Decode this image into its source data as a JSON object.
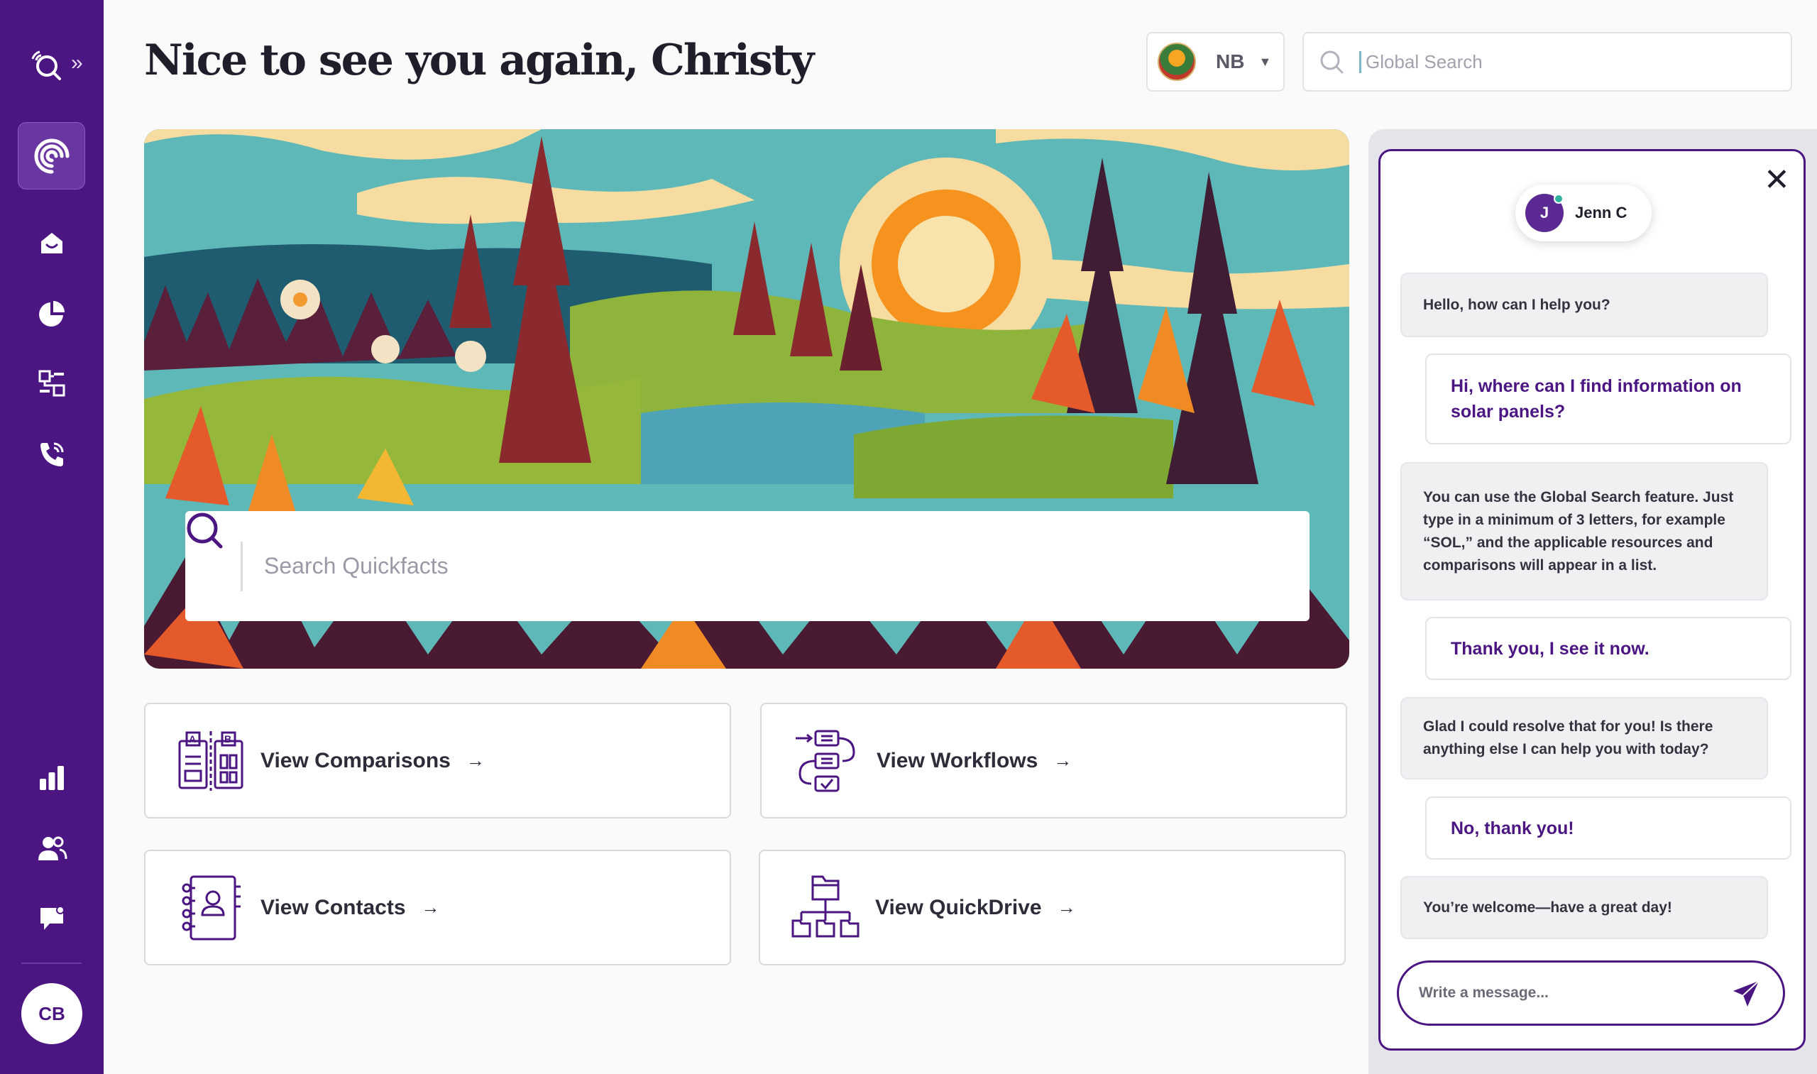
{
  "header": {
    "greeting": "Nice to see you again, Christy",
    "province": "NB",
    "global_search_placeholder": "Global Search"
  },
  "sidebar": {
    "items": [
      {
        "icon": "search-signal-icon"
      },
      {
        "icon": "swirl-logo-icon",
        "active": true
      },
      {
        "icon": "home-icon"
      },
      {
        "icon": "pie-chart-icon"
      },
      {
        "icon": "workflow-icon"
      },
      {
        "icon": "phone-icon"
      },
      {
        "icon": "bar-chart-icon"
      },
      {
        "icon": "users-icon"
      },
      {
        "icon": "chat-bubble-icon"
      }
    ],
    "expand_glyph": "»",
    "user_initials": "CB",
    "colors": {
      "background": "#4b1582",
      "active": "#6a37a2"
    }
  },
  "hero": {
    "quickfacts_placeholder": "Search Quickfacts"
  },
  "cards": [
    {
      "label": "View Comparisons",
      "arrow": "→",
      "icon": "comparison-icon"
    },
    {
      "label": "View Workflows",
      "arrow": "→",
      "icon": "workflow-steps-icon"
    },
    {
      "label": "View Contacts",
      "arrow": "→",
      "icon": "contacts-book-icon"
    },
    {
      "label": "View QuickDrive",
      "arrow": "→",
      "icon": "folder-tree-icon"
    }
  ],
  "chat": {
    "agent_name": "Jenn C",
    "agent_initial": "J",
    "close_glyph": "✕",
    "messages": [
      {
        "from": "agent",
        "text": "Hello, how can I help you?"
      },
      {
        "from": "user",
        "text": "Hi, where can I find information on solar panels?"
      },
      {
        "from": "agent",
        "text": "You can use the Global Search feature. Just type in a minimum of 3 letters, for example “SOL,” and the applicable resources and comparisons will appear in a list."
      },
      {
        "from": "user",
        "text": "Thank you, I see it now."
      },
      {
        "from": "agent",
        "text": "Glad I could resolve that for you! Is there anything else I can help you with today?"
      },
      {
        "from": "user",
        "text": "No, thank you!"
      },
      {
        "from": "agent",
        "text": "You’re welcome—have a great day!"
      }
    ],
    "input_placeholder": "Write a message..."
  },
  "colors": {
    "brand": "#4b1582",
    "online": "#2fb39f"
  }
}
